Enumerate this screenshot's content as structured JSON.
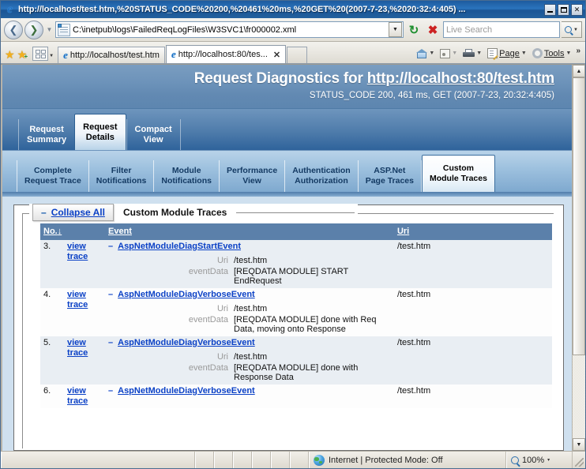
{
  "window": {
    "title": "http://localhost/test.htm,%20STATUS_CODE%20200,%20461%20ms,%20GET%20(2007-7-23,%2020:32:4:405) ...",
    "icon": "ie-logo-icon",
    "minimize_label": "Minimize",
    "maximize_label": "Maximize",
    "close_label": "Close"
  },
  "addressbar": {
    "back_label": "Back",
    "forward_label": "Forward",
    "recent_label": "Recent Pages",
    "url": "C:\\inetpub\\logs\\FailedReqLogFiles\\W3SVC1\\fr000002.xml",
    "dropdown_label": "History",
    "refresh_label": "Refresh",
    "stop_label": "Stop",
    "search_placeholder": "Live Search",
    "search_value": "",
    "search_button_label": "Search"
  },
  "tabbar": {
    "favorites_label": "Favorites Center",
    "add_favorite_label": "Add to Favorites",
    "quick_tabs_label": "Quick Tabs",
    "tab_list_label": "Tab List",
    "tabs": [
      {
        "label": "http://localhost/test.htm",
        "active": false,
        "closable": false
      },
      {
        "label": "http://localhost:80/tes...",
        "active": true,
        "closable": true
      },
      {
        "label": "",
        "active": false,
        "closable": false
      }
    ],
    "commands": [
      {
        "label": "",
        "icon": "home-icon",
        "caret": true
      },
      {
        "label": "",
        "icon": "feeds-icon",
        "caret": true,
        "caret_dim": true
      },
      {
        "label": "",
        "icon": "print-icon",
        "caret": true
      },
      {
        "label": "Page",
        "icon": "page-icon",
        "caret": true
      },
      {
        "label": "Tools",
        "icon": "tools-gear-icon",
        "caret": true
      }
    ],
    "overflow_label": "»"
  },
  "banner": {
    "title_prefix": "Request Diagnostics for ",
    "title_url": "http://localhost:80/test.htm",
    "subtitle": "STATUS_CODE 200, 461 ms, GET (2007-7-23, 20:32:4:405)"
  },
  "primary_tabs": [
    {
      "line1": "Request",
      "line2": "Summary",
      "active": false
    },
    {
      "line1": "Request",
      "line2": "Details",
      "active": true
    },
    {
      "line1": "Compact",
      "line2": "View",
      "active": false
    }
  ],
  "secondary_tabs": [
    {
      "line1": "Complete",
      "line2": "Request Trace",
      "active": false
    },
    {
      "line1": "Filter",
      "line2": "Notifications",
      "active": false
    },
    {
      "line1": "Module",
      "line2": "Notifications",
      "active": false
    },
    {
      "line1": "Performance",
      "line2": "View",
      "active": false
    },
    {
      "line1": "Authentication",
      "line2": "Authorization",
      "active": false
    },
    {
      "line1": "ASP.Net",
      "line2": "Page Traces",
      "active": false
    },
    {
      "line1": "Custom",
      "line2": "Module Traces",
      "active": true
    }
  ],
  "panel": {
    "collapse_minus": "–",
    "collapse_label": "Collapse All",
    "title": "Custom Module Traces"
  },
  "table": {
    "headers": {
      "no": "No.",
      "sort_indicator": "↓",
      "view": "",
      "event": "Event",
      "uri": "Uri"
    },
    "view_label_line1": "view",
    "view_label_line2": "trace",
    "expand_marker": "–",
    "rows": [
      {
        "no": "3.",
        "event": "AspNetModuleDiagStartEvent",
        "uri": "/test.htm",
        "details": [
          {
            "key": "Uri",
            "value": "/test.htm"
          },
          {
            "key": "eventData",
            "value": "[REQDATA MODULE] START EndRequest"
          }
        ]
      },
      {
        "no": "4.",
        "event": "AspNetModuleDiagVerboseEvent",
        "uri": "/test.htm",
        "details": [
          {
            "key": "Uri",
            "value": "/test.htm"
          },
          {
            "key": "eventData",
            "value": "[REQDATA MODULE] done with Req Data, moving onto Response"
          }
        ]
      },
      {
        "no": "5.",
        "event": "AspNetModuleDiagVerboseEvent",
        "uri": "/test.htm",
        "details": [
          {
            "key": "Uri",
            "value": "/test.htm"
          },
          {
            "key": "eventData",
            "value": "[REQDATA MODULE] done with Response Data"
          }
        ]
      },
      {
        "no": "6.",
        "event": "AspNetModuleDiagVerboseEvent",
        "uri": "/test.htm",
        "details": []
      }
    ]
  },
  "statusbar": {
    "message": "",
    "zone": "Internet | Protected Mode: Off",
    "zone_icon": "internet-globe-icon",
    "zoom": "100%",
    "zoom_caret": "▾"
  },
  "colors": {
    "accent": "#5b80aa",
    "link": "#0b41c6",
    "banner": "#6289b2",
    "content_bg": "#cfe0ef"
  }
}
